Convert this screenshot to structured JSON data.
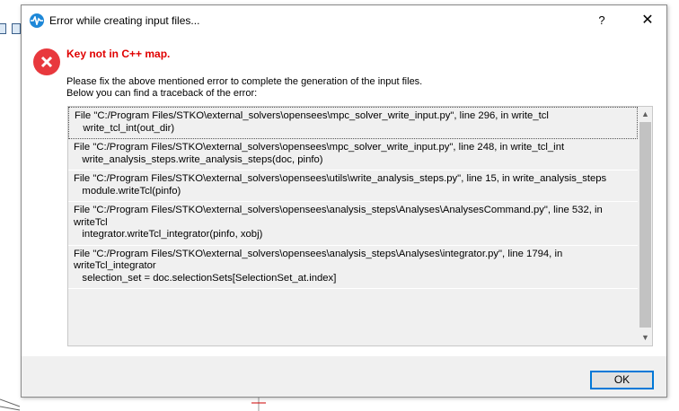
{
  "dialog": {
    "title": "Error while creating input files...",
    "help_label": "?",
    "close_label": "✕",
    "error_title": "Key not in C++ map.",
    "message_line1": "Please fix the above mentioned error to complete the generation of the input files.",
    "message_line2": "Below you can find a traceback of the error:",
    "ok_label": "OK"
  },
  "traceback": [
    "File \"C:/Program Files/STKO\\external_solvers\\opensees\\mpc_solver_write_input.py\", line 296, in write_tcl\n   write_tcl_int(out_dir)\n",
    "File \"C:/Program Files/STKO\\external_solvers\\opensees\\mpc_solver_write_input.py\", line 248, in write_tcl_int\n   write_analysis_steps.write_analysis_steps(doc, pinfo)\n",
    "File \"C:/Program Files/STKO\\external_solvers\\opensees\\utils\\write_analysis_steps.py\", line 15, in write_analysis_steps\n   module.writeTcl(pinfo)\n",
    "File \"C:/Program Files/STKO\\external_solvers\\opensees\\analysis_steps\\Analyses\\AnalysesCommand.py\", line 532, in\nwriteTcl\n   integrator.writeTcl_integrator(pinfo, xobj)\n",
    "File \"C:/Program Files/STKO\\external_solvers\\opensees\\analysis_steps\\Analyses\\integrator.py\", line 1794, in\nwriteTcl_integrator\n   selection_set = doc.selectionSets[SelectionSet_at.index]\n"
  ],
  "colors": {
    "error_red": "#e00000",
    "accent_blue": "#0078d7"
  }
}
